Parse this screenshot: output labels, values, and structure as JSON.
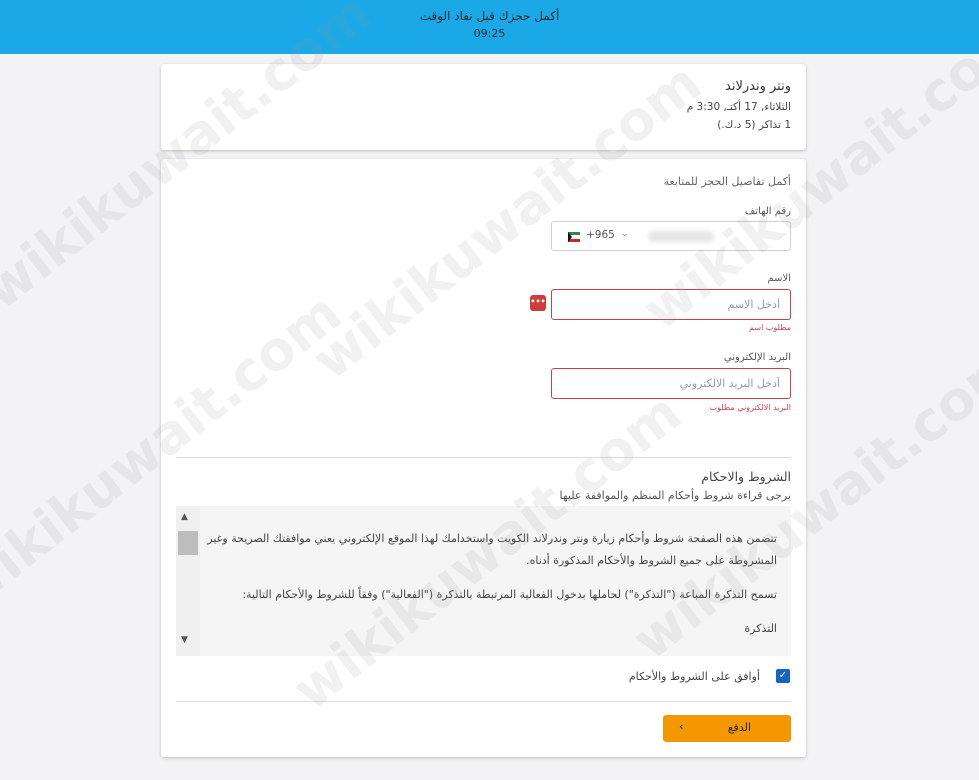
{
  "banner": {
    "message": "أكمل حجزك قبل نفاد الوقت",
    "time": "09:25"
  },
  "event": {
    "name": "ونتر وندرلاند",
    "date": "الثلاثاء, 17 أكتـ, 3:30 م",
    "tickets": "1 تذاكر (5 د.ك.)"
  },
  "form": {
    "heading": "أكمل تفاصيل الحجز للمتابعة",
    "phone": {
      "label": "رقم الهاتف",
      "dial_code": "+965",
      "flag_icon": "kuwait-flag-icon"
    },
    "name": {
      "label": "الاسم",
      "placeholder": "أدخل الاسم",
      "error": "مطلوب اسم"
    },
    "email": {
      "label": "البريد الإلكتروني",
      "placeholder": "أدخل البريد الالكتروني",
      "error": "البريد الالكتروني مطلوب"
    }
  },
  "terms": {
    "title": "الشروط والاحكام",
    "subtitle": "يرجى قراءة شروط وأحكام المنظم والموافقة عليها",
    "paragraphs": [
      "تتضمن هذه الصفحة شروط وأحكام زيارة ونتر وندرلاند الكويت واستخدامك لهذا الموقع الإلكتروني يعني موافقتك الصريحة وغير المشروطة على جميع الشروط والأحكام المذكورة أدناه.",
      "تسمح التذكرة المباعة (\"التذكرة\") لحاملها بدخول الفعالية المرتبطة بالتذكرة (\"الفعالية\") وفقاً للشروط والأحكام التالية:",
      "التذكرة"
    ],
    "agree_label": "أوافق على الشروط والأحكام",
    "agree_checked": true
  },
  "pay_button": {
    "label": "الدفع"
  },
  "watermark": "wikikuwait.com",
  "colors": {
    "banner": "#1aa9e6",
    "error": "#c4434b",
    "pay_button": "#f39800",
    "checkbox": "#1565c0"
  }
}
